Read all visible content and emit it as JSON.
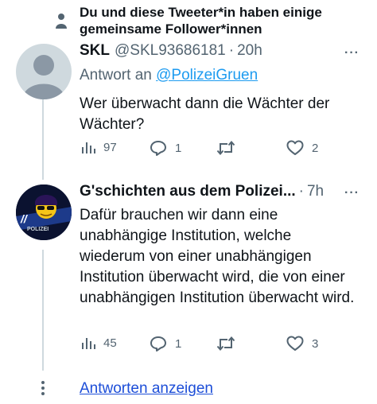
{
  "context": {
    "text": "Du und diese Tweeter*in haben einige gemeinsame Follower*innen"
  },
  "tweets": [
    {
      "display_name": "SKL",
      "handle": "@SKL93686181",
      "separator": "·",
      "time": "20h",
      "reply_prefix": "Antwort an",
      "reply_to": "@PolizeiGruen",
      "text": "Wer überwacht dann die Wächter der Wächter?",
      "views": "97",
      "replies": "1",
      "retweets": "",
      "likes": "2"
    },
    {
      "display_name": "G'schichten aus dem Polizei...",
      "separator": "·",
      "time": "7h",
      "text": "Dafür brauchen wir dann eine unabhängige Institution, welche wiederum von einer unabhängigen Institution überwacht wird,  die von einer unabhängigen Institution überwacht wird.",
      "views": "45",
      "replies": "1",
      "retweets": "",
      "likes": "3"
    }
  ],
  "more_label": "···",
  "show_replies_label": "Antworten anzeigen",
  "colors": {
    "link": "#1d9bf0",
    "muted": "#536471",
    "thread_line": "#cfd9de",
    "text": "#0f1419"
  }
}
